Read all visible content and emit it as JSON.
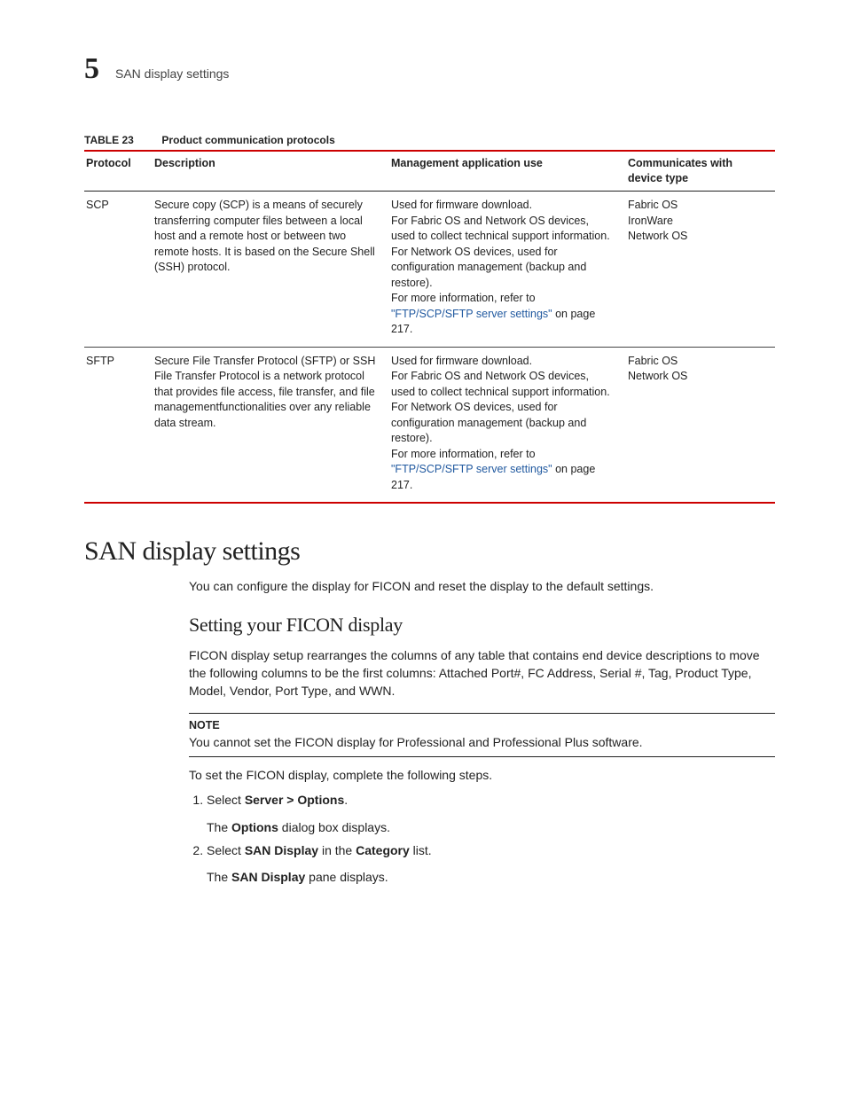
{
  "header": {
    "chapter_number": "5",
    "chapter_title": "SAN display settings"
  },
  "table": {
    "label": "TABLE 23",
    "title": "Product communication protocols",
    "headers": {
      "protocol": "Protocol",
      "description": "Description",
      "use": "Management application use",
      "device": "Communicates with device type"
    },
    "rows": [
      {
        "protocol": "SCP",
        "description": "Secure copy (SCP) is a means of securely transferring computer files between a local host and a remote host or between two remote hosts. It is based on the Secure Shell (SSH) protocol.",
        "use_pre": "Used for firmware download.\nFor Fabric OS and Network OS devices, used to collect technical support information.\nFor Network OS devices, used for configuration management (backup and restore).\nFor more information, refer to ",
        "use_link": "\"FTP/SCP/SFTP server settings\"",
        "use_post": " on page 217.",
        "device": "Fabric OS\nIronWare\nNetwork OS"
      },
      {
        "protocol": "SFTP",
        "description": "Secure File Transfer Protocol (SFTP) or SSH File Transfer Protocol is a network protocol that provides file access, file transfer, and file managementfunctionalities over any reliable data stream.",
        "use_pre": "Used for firmware download.\nFor Fabric OS and Network OS devices, used to collect technical support information.\nFor Network OS devices, used for configuration management (backup and restore).\nFor more information, refer to ",
        "use_link": "\"FTP/SCP/SFTP server settings\"",
        "use_post": " on page 217.",
        "device": "Fabric OS\nNetwork OS"
      }
    ]
  },
  "section": {
    "heading": "SAN display settings",
    "intro": "You can configure the display for FICON and reset the display to the default settings.",
    "subsection": {
      "heading": "Setting your FICON display",
      "para": "FICON display setup rearranges the columns of any table that contains end device descriptions to move the following columns to be the first columns: Attached Port#, FC Address, Serial #, Tag, Product Type, Model, Vendor, Port Type, and WWN.",
      "note_label": "NOTE",
      "note_body": "You cannot set the FICON display for Professional and Professional Plus software.",
      "lead": "To set the FICON display, complete the following steps.",
      "steps": [
        {
          "pre": "Select ",
          "bold": "Server > Options",
          "post": ".",
          "sub_pre": "The ",
          "sub_bold": "Options",
          "sub_post": " dialog box displays."
        },
        {
          "pre": "Select ",
          "bold": "SAN Display",
          "mid": " in the ",
          "bold2": "Category",
          "post": " list.",
          "sub_pre": "The ",
          "sub_bold": "SAN Display",
          "sub_post": " pane displays."
        }
      ]
    }
  }
}
